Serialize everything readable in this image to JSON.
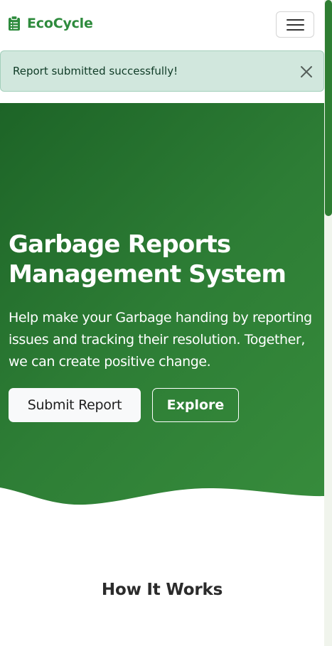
{
  "navbar": {
    "brand_name": "EcoCycle",
    "brand_icon": "clipboard-icon",
    "menu_icon": "hamburger-menu-icon"
  },
  "alert": {
    "message": "Report submitted successfully!",
    "close_icon": "close-icon"
  },
  "hero": {
    "title_line1": "Garbage Reports",
    "title_line2": "Management System",
    "description": "Help make your Garbage handing by reporting issues and tracking their resolution. Together, we can create positive change.",
    "primary_button": "Submit Report",
    "secondary_button": "Explore"
  },
  "how_it_works": {
    "title": "How It Works"
  },
  "colors": {
    "brand": "#2e8b3d",
    "hero_gradient_start": "#1d6427",
    "hero_gradient_end": "#378c3c",
    "alert_background": "#d1e7dd",
    "alert_text": "#0f3b26",
    "scrollbar_thumb": "#2e7d32"
  }
}
